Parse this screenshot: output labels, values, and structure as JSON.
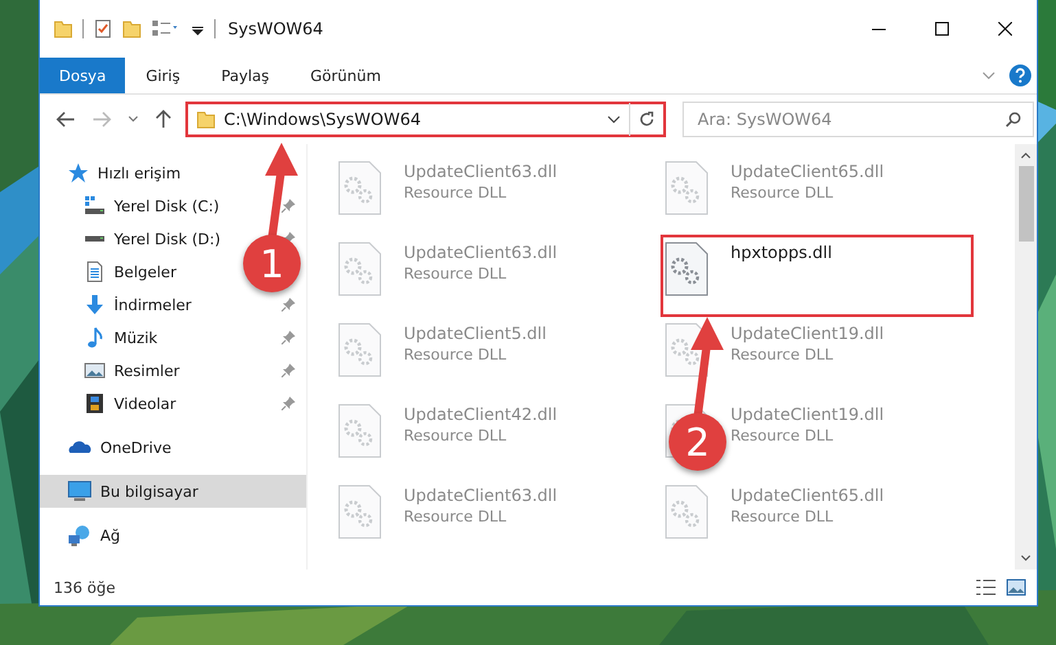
{
  "window": {
    "title": "SysWOW64"
  },
  "ribbon_tabs": [
    {
      "label": "Dosya",
      "selected": true
    },
    {
      "label": "Giriş",
      "selected": false
    },
    {
      "label": "Paylaş",
      "selected": false
    },
    {
      "label": "Görünüm",
      "selected": false
    }
  ],
  "address_bar": {
    "value": "C:\\Windows\\SysWOW64",
    "highlighted": true
  },
  "search": {
    "placeholder": "Ara: SysWOW64"
  },
  "sidebar": {
    "items": [
      {
        "label": "Hızlı erişim",
        "kind": "star",
        "selected": false,
        "children": [
          {
            "label": "Yerel Disk (C:)",
            "kind": "system-drive",
            "pinned": true,
            "selected": false
          },
          {
            "label": "Yerel Disk (D:)",
            "kind": "drive",
            "pinned": true,
            "selected": false
          },
          {
            "label": "Belgeler",
            "kind": "document",
            "pinned": false,
            "selected": false
          },
          {
            "label": "İndirmeler",
            "kind": "download",
            "pinned": true,
            "selected": false
          },
          {
            "label": "Müzik",
            "kind": "music",
            "pinned": true,
            "selected": false
          },
          {
            "label": "Resimler",
            "kind": "pictures",
            "pinned": true,
            "selected": false
          },
          {
            "label": "Videolar",
            "kind": "video",
            "pinned": true,
            "selected": false
          }
        ]
      },
      {
        "label": "OneDrive",
        "kind": "cloud",
        "selected": false
      },
      {
        "label": "Bu bilgisayar",
        "kind": "computer",
        "selected": true
      },
      {
        "label": "Ağ",
        "kind": "network",
        "selected": false
      }
    ]
  },
  "files": [
    {
      "name": "UpdateClient63.dll",
      "type": "Resource DLL",
      "blurred": true,
      "highlighted": false
    },
    {
      "name": "UpdateClient65.dll",
      "type": "Resource DLL",
      "blurred": true,
      "highlighted": false
    },
    {
      "name": "UpdateClient63.dll",
      "type": "Resource DLL",
      "blurred": true,
      "highlighted": false
    },
    {
      "name": "hpxtopps.dll",
      "blurred": false,
      "highlighted": true
    },
    {
      "name": "UpdateClient5.dll",
      "type": "Resource DLL",
      "blurred": true,
      "highlighted": false
    },
    {
      "name": "UpdateClient19.dll",
      "type": "Resource DLL",
      "blurred": true,
      "highlighted": false
    },
    {
      "name": "UpdateClient42.dll",
      "type": "Resource DLL",
      "blurred": true,
      "highlighted": false
    },
    {
      "name": "UpdateClient19.dll",
      "type": "Resource DLL",
      "blurred": true,
      "highlighted": false
    },
    {
      "name": "UpdateClient63.dll",
      "type": "Resource DLL",
      "blurred": true,
      "highlighted": false
    },
    {
      "name": "UpdateClient65.dll",
      "type": "Resource DLL",
      "blurred": true,
      "highlighted": false
    }
  ],
  "status_bar": {
    "count": "136 öğe"
  },
  "callouts": [
    {
      "label": "1"
    },
    {
      "label": "2"
    }
  ]
}
